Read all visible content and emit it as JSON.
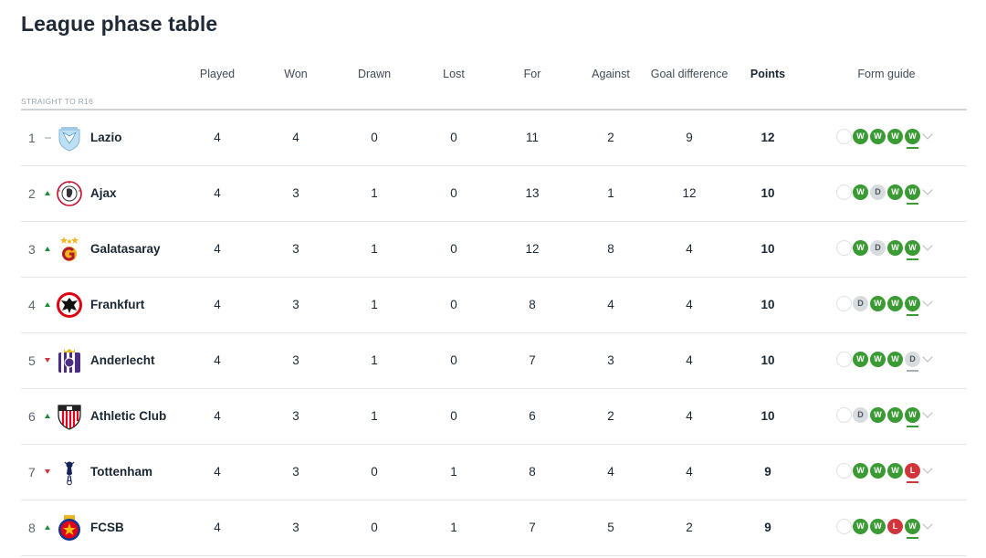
{
  "title": "League phase table",
  "headers": {
    "played": "Played",
    "won": "Won",
    "drawn": "Drawn",
    "lost": "Lost",
    "for": "For",
    "against": "Against",
    "gd": "Goal difference",
    "points": "Points",
    "form": "Form guide"
  },
  "section_label": "STRAIGHT TO R16",
  "colors": {
    "win": "#3a9a33",
    "draw": "#d8dcdf",
    "loss": "#d0353c",
    "up": "#1f8b3b",
    "down": "#d0353c"
  },
  "rows": [
    {
      "pos": "1",
      "move": "same",
      "team": "Lazio",
      "crest": "lazio-crest-icon",
      "played": "4",
      "won": "4",
      "drawn": "0",
      "lost": "0",
      "for": "11",
      "against": "2",
      "gd": "9",
      "points": "12",
      "form": [
        "W",
        "W",
        "W",
        "W"
      ]
    },
    {
      "pos": "2",
      "move": "up",
      "team": "Ajax",
      "crest": "ajax-crest-icon",
      "played": "4",
      "won": "3",
      "drawn": "1",
      "lost": "0",
      "for": "13",
      "against": "1",
      "gd": "12",
      "points": "10",
      "form": [
        "W",
        "D",
        "W",
        "W"
      ]
    },
    {
      "pos": "3",
      "move": "up",
      "team": "Galatasaray",
      "crest": "galatasaray-crest-icon",
      "played": "4",
      "won": "3",
      "drawn": "1",
      "lost": "0",
      "for": "12",
      "against": "8",
      "gd": "4",
      "points": "10",
      "form": [
        "W",
        "D",
        "W",
        "W"
      ]
    },
    {
      "pos": "4",
      "move": "up",
      "team": "Frankfurt",
      "crest": "frankfurt-crest-icon",
      "played": "4",
      "won": "3",
      "drawn": "1",
      "lost": "0",
      "for": "8",
      "against": "4",
      "gd": "4",
      "points": "10",
      "form": [
        "D",
        "W",
        "W",
        "W"
      ]
    },
    {
      "pos": "5",
      "move": "down",
      "team": "Anderlecht",
      "crest": "anderlecht-crest-icon",
      "played": "4",
      "won": "3",
      "drawn": "1",
      "lost": "0",
      "for": "7",
      "against": "3",
      "gd": "4",
      "points": "10",
      "form": [
        "W",
        "W",
        "W",
        "D"
      ]
    },
    {
      "pos": "6",
      "move": "up",
      "team": "Athletic Club",
      "crest": "athletic-club-crest-icon",
      "played": "4",
      "won": "3",
      "drawn": "1",
      "lost": "0",
      "for": "6",
      "against": "2",
      "gd": "4",
      "points": "10",
      "form": [
        "D",
        "W",
        "W",
        "W"
      ]
    },
    {
      "pos": "7",
      "move": "down",
      "team": "Tottenham",
      "crest": "tottenham-crest-icon",
      "played": "4",
      "won": "3",
      "drawn": "0",
      "lost": "1",
      "for": "8",
      "against": "4",
      "gd": "4",
      "points": "9",
      "form": [
        "W",
        "W",
        "W",
        "L"
      ]
    },
    {
      "pos": "8",
      "move": "up",
      "team": "FCSB",
      "crest": "fcsb-crest-icon",
      "played": "4",
      "won": "3",
      "drawn": "0",
      "lost": "1",
      "for": "7",
      "against": "5",
      "gd": "2",
      "points": "9",
      "form": [
        "W",
        "W",
        "L",
        "W"
      ]
    }
  ]
}
